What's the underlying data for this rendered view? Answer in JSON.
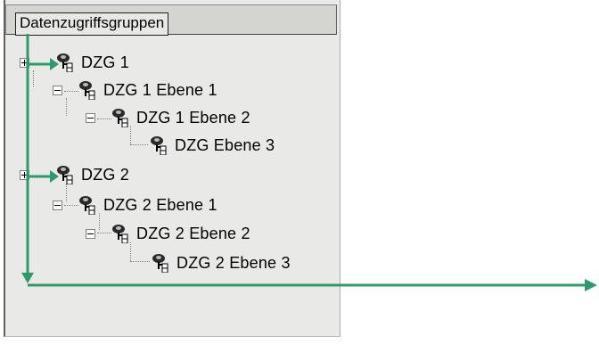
{
  "panel": {
    "header_label": "Datenzugriffsgruppen"
  },
  "tree": [
    {
      "label": "DZG 1",
      "expander": "plus"
    },
    {
      "label": "DZG 1 Ebene 1",
      "expander": "minus"
    },
    {
      "label": "DZG 1 Ebene 2",
      "expander": "minus"
    },
    {
      "label": "DZG Ebene 3",
      "expander": "none"
    },
    {
      "label": "DZG 2",
      "expander": "plus"
    },
    {
      "label": "DZG 2 Ebene 1",
      "expander": "minus"
    },
    {
      "label": "DZG 2 Ebene 2",
      "expander": "minus"
    },
    {
      "label": "DZG 2 Ebene 3",
      "expander": "none"
    }
  ],
  "colors": {
    "arrow": "#2e9a6b",
    "panel_bg": "#e9e9e7"
  },
  "icons": {
    "node": "group-tree-icon"
  }
}
